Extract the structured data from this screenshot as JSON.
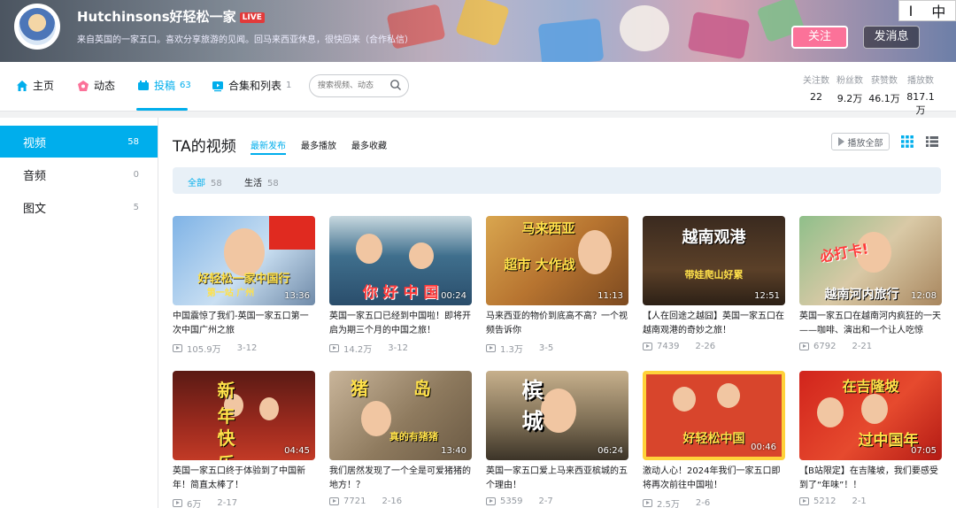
{
  "header": {
    "username": "Hutchinsons好轻松一家",
    "live_badge": "LIVE",
    "signature": "来自英国的一家五口。喜欢分享旅游的见闻。回马来西亚休息，很快回来（合作私信）",
    "follow_label": "关注",
    "message_label": "发消息",
    "ime": {
      "left": "I",
      "right": "中"
    }
  },
  "nav": {
    "items": [
      {
        "label": "主页",
        "icon": "home-icon"
      },
      {
        "label": "动态",
        "icon": "dynamic-icon"
      },
      {
        "label": "投稿",
        "count": "63",
        "icon": "upload-icon"
      },
      {
        "label": "合集和列表",
        "count": "1",
        "icon": "collection-icon"
      }
    ],
    "search_placeholder": "搜索视频、动态"
  },
  "stats": [
    {
      "label": "关注数",
      "value": "22"
    },
    {
      "label": "粉丝数",
      "value": "9.2万"
    },
    {
      "label": "获赞数",
      "value": "46.1万"
    },
    {
      "label": "播放数",
      "value": "817.1万"
    }
  ],
  "sidebar": [
    {
      "label": "视频",
      "count": "58"
    },
    {
      "label": "音频",
      "count": "0"
    },
    {
      "label": "图文",
      "count": "5"
    }
  ],
  "main": {
    "title": "TA的视频",
    "sorts": [
      "最新发布",
      "最多播放",
      "最多收藏"
    ],
    "play_all": "播放全部",
    "filters": [
      {
        "label": "全部",
        "count": "58"
      },
      {
        "label": "生活",
        "count": "58"
      }
    ]
  },
  "videos": [
    {
      "title": "中国震惊了我们-英国一家五口第一次中国广州之旅",
      "views": "105.9万",
      "date": "3-12",
      "duration": "13:36",
      "thumb_text": "好轻松一家中国行",
      "thumb_sub": "第一站 广州"
    },
    {
      "title": "英国一家五口已经到中国啦！即将开启为期三个月的中国之旅！",
      "views": "14.2万",
      "date": "3-12",
      "duration": "00:24",
      "thumb_text": "你 好 中 国"
    },
    {
      "title": "马来西亚的物价到底高不高？一个视频告诉你",
      "views": "1.3万",
      "date": "3-5",
      "duration": "11:13",
      "thumb_text": "马来西亚",
      "thumb_sub": "超市 大作战"
    },
    {
      "title": "【人在回途之越囧】英国一家五口在越南观港的奇妙之旅！",
      "views": "7439",
      "date": "2-26",
      "duration": "12:51",
      "thumb_text": "越南观港",
      "thumb_sub": "带娃爬山好累"
    },
    {
      "title": "英国一家五口在越南河内疯狂的一天——咖啡、演出和一个让人吃惊",
      "views": "6792",
      "date": "2-21",
      "duration": "12:08",
      "thumb_text": "必打卡!",
      "thumb_sub": "越南河内旅行"
    },
    {
      "title": "英国一家五口终于体验到了中国新年！简直太棒了！",
      "views": "6万",
      "date": "2-17",
      "duration": "04:45",
      "thumb_text": "新 年",
      "thumb_sub": "快 乐"
    },
    {
      "title": "我们居然发现了一个全是可爱猪猪的地方！？",
      "views": "7721",
      "date": "2-16",
      "duration": "13:40",
      "thumb_text": "猪 岛",
      "thumb_sub": "真的有猪猪"
    },
    {
      "title": "英国一家五口爱上马来西亚槟城的五个理由！",
      "views": "5359",
      "date": "2-7",
      "duration": "06:24",
      "thumb_text": "槟 城"
    },
    {
      "title": "激动人心！2024年我们一家五口即将再次前往中国啦！",
      "views": "2.5万",
      "date": "2-6",
      "duration": "00:46",
      "thumb_text": "好轻松中国"
    },
    {
      "title": "【B站限定】在吉隆坡，我们要感受到了“年味”！！",
      "views": "5212",
      "date": "2-1",
      "duration": "07:05",
      "thumb_text": "在吉隆坡",
      "thumb_sub": "过中国年"
    }
  ],
  "colors": {
    "accent": "#00aeec",
    "follow": "#fb7299"
  }
}
